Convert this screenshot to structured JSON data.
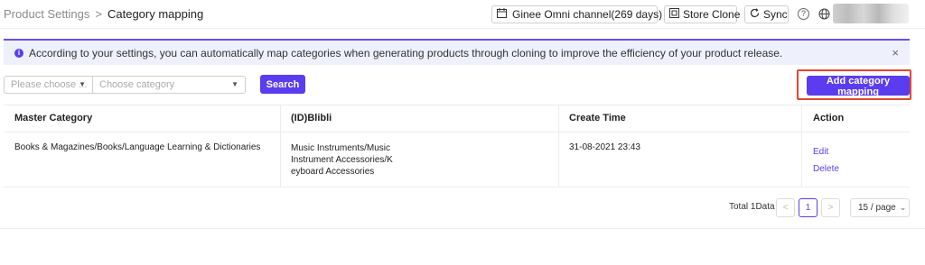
{
  "breadcrumb": {
    "parent": "Product Settings",
    "separator": ">",
    "current": "Category mapping"
  },
  "header": {
    "channel_label": "Ginee Omni channel(269 days)",
    "clone_label": "Store Clone",
    "sync_label": "Sync",
    "help_glyph": "?"
  },
  "notice": {
    "text": "According to your settings, you can automatically map categories when generating products through cloning to improve the efficiency of your product release.",
    "info_glyph": "i",
    "close_glyph": "×"
  },
  "filters": {
    "select1_placeholder": "Please choose ...",
    "select2_placeholder": "Choose category",
    "search_label": "Search"
  },
  "actions": {
    "add_label": "Add category mapping"
  },
  "table": {
    "columns": [
      "Master Category",
      "(ID)Blibli",
      "Create Time",
      "Action"
    ],
    "rows": [
      {
        "master": "Books & Magazines/Books/Language Learning & Dictionaries",
        "blibli_lines": [
          "Music Instruments/Music",
          "Instrument Accessories/K",
          "eyboard Accessories"
        ],
        "create_time": "31-08-2021 23:43",
        "edit": "Edit",
        "delete": "Delete"
      }
    ]
  },
  "pagination": {
    "total": "Total 1Data",
    "prev": "<",
    "current_page": "1",
    "next": ">",
    "per_page": "15 / page"
  },
  "colors": {
    "accent": "#5b3df0",
    "highlight_outline": "#e8452e",
    "notice_bg": "#eef0fc"
  }
}
